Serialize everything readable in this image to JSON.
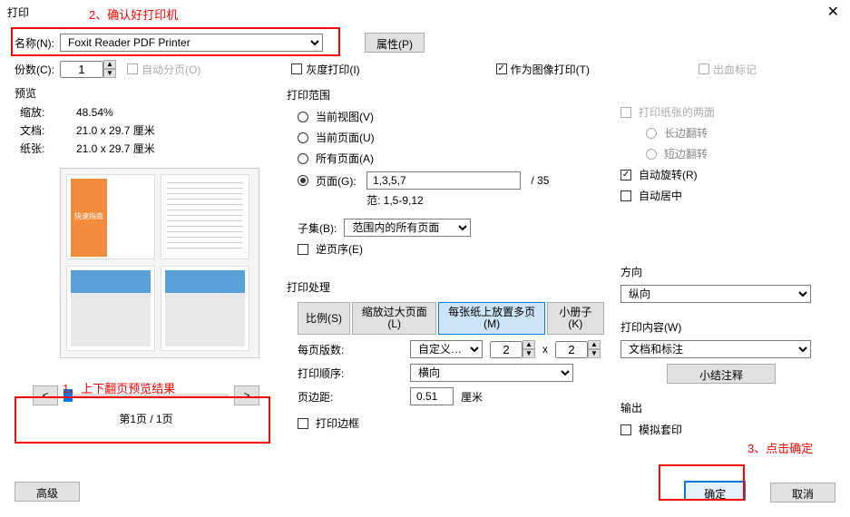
{
  "title": "打印",
  "annotations": {
    "a1": "2、确认好打印机",
    "a2": "1、上下翻页预览结果",
    "a3": "3、点击确定"
  },
  "top": {
    "name_label": "名称(N):",
    "printer": "Foxit Reader PDF Printer",
    "properties_btn": "属性(P)",
    "copies_label": "份数(C):",
    "copies_value": "1",
    "collate": "自动分页(O)",
    "grayscale": "灰度打印(I)",
    "as_image": "作为图像打印(T)",
    "bleed": "出血标记"
  },
  "preview": {
    "header": "预览",
    "zoom_label": "缩放:",
    "zoom_value": "48.54%",
    "doc_label": "文档:",
    "doc_value": "21.0 x 29.7 厘米",
    "paper_label": "纸张:",
    "paper_value": "21.0 x 29.7 厘米",
    "page_counter": "第1页 / 1页"
  },
  "range": {
    "header": "打印范围",
    "current_view": "当前视图(V)",
    "current_page": "当前页面(U)",
    "all_pages": "所有页面(A)",
    "pages_label": "页面(G):",
    "pages_value": "1,3,5,7",
    "total": "/ 35",
    "example": "范: 1,5-9,12",
    "subset_label": "子集(B):",
    "subset_value": "范围内的所有页面",
    "reverse": "逆页序(E)"
  },
  "handling": {
    "header": "打印处理",
    "tab_scale": "比例(S)",
    "tab_large": "缩放过大页面(L)",
    "tab_multi": "每张纸上放置多页(M)",
    "tab_booklet": "小册子(K)",
    "pps_label": "每页版数:",
    "pps_value": "自定义…",
    "cols": "2",
    "by": "x",
    "rows": "2",
    "order_label": "打印顺序:",
    "order_value": "横向",
    "margin_label": "页边距:",
    "margin_value": "0.51",
    "margin_unit": "厘米",
    "border": "打印边框"
  },
  "right": {
    "duplex": "打印纸张的两面",
    "long_edge": "长边翻转",
    "short_edge": "短边翻转",
    "auto_rotate": "自动旋转(R)",
    "auto_center": "自动居中",
    "orient_header": "方向",
    "orient_value": "纵向",
    "content_header": "打印内容(W)",
    "content_value": "文档和标注",
    "summarize_btn": "小结注释",
    "output_header": "输出",
    "simulate": "模拟套印"
  },
  "bottom": {
    "advanced": "高级",
    "ok": "确定",
    "cancel": "取消"
  }
}
